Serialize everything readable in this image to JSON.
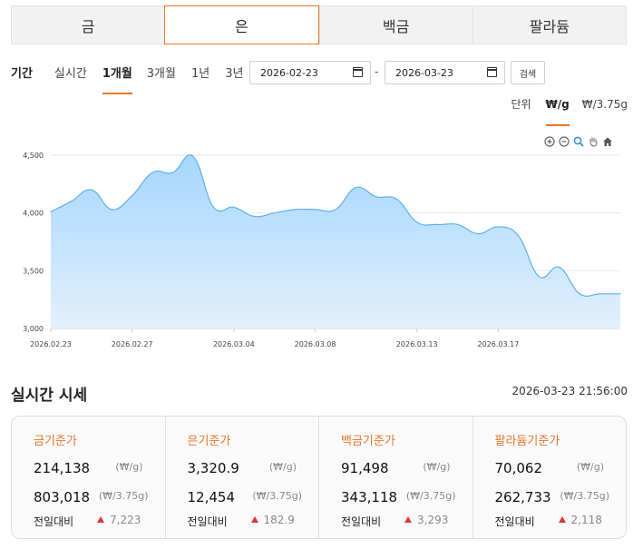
{
  "tabs": [
    {
      "label": "금",
      "active": false
    },
    {
      "label": "은",
      "active": true
    },
    {
      "label": "백금",
      "active": false
    },
    {
      "label": "팔라듐",
      "active": false
    }
  ],
  "period": {
    "label": "기간",
    "options": [
      "실시간",
      "1개월",
      "3개월",
      "1년",
      "3년"
    ],
    "active": "1개월",
    "start_date": "2026-02-23",
    "end_date": "2026-03-23",
    "search_label": "검색"
  },
  "units": {
    "label": "단위",
    "options": [
      "₩/g",
      "₩/3.75g"
    ],
    "active": "₩/g"
  },
  "toolbar_icons": [
    "zoom-in-icon",
    "zoom-out-icon",
    "magnify-icon",
    "pan-hand-icon",
    "home-icon"
  ],
  "colors": {
    "accent": "#e8742c",
    "area_top": "#a6d6ff",
    "area_bottom": "#e2f0fd",
    "line": "#5ab0ec",
    "up": "#e0332f"
  },
  "chart_data": {
    "type": "area",
    "title": "",
    "xlabel": "",
    "ylabel": "",
    "ylim": [
      3000,
      4500
    ],
    "yticks": [
      3000,
      3500,
      4000,
      4500
    ],
    "ytick_labels": [
      "3,000",
      "3,500",
      "4,000",
      "4,500"
    ],
    "xtick_labels": [
      "2026.02.23",
      "2026.02.27",
      "2026.03.04",
      "2026.03.08",
      "2026.03.13",
      "2026.03.17"
    ],
    "grid": true,
    "x": [
      "2026.02.23",
      "2026.02.24",
      "2026.02.25",
      "2026.02.26",
      "2026.02.27",
      "2026.02.28",
      "2026.03.01",
      "2026.03.02",
      "2026.03.03",
      "2026.03.04",
      "2026.03.05",
      "2026.03.06",
      "2026.03.07",
      "2026.03.08",
      "2026.03.09",
      "2026.03.10",
      "2026.03.11",
      "2026.03.12",
      "2026.03.13",
      "2026.03.14",
      "2026.03.15",
      "2026.03.16",
      "2026.03.17",
      "2026.03.18",
      "2026.03.19",
      "2026.03.20",
      "2026.03.21",
      "2026.03.22",
      "2026.03.23"
    ],
    "values": [
      4010,
      4100,
      4200,
      4030,
      4150,
      4350,
      4350,
      4490,
      4050,
      4050,
      3970,
      4000,
      4030,
      4030,
      4030,
      4220,
      4140,
      4120,
      3920,
      3900,
      3900,
      3820,
      3880,
      3800,
      3450,
      3530,
      3300,
      3300,
      3300
    ]
  },
  "realtime": {
    "title": "실시간 시세",
    "timestamp": "2026-03-23 21:56:00",
    "items": [
      {
        "title": "금기준가",
        "per_g": "214,138",
        "per_g_unit": "(₩/g)",
        "per_don": "803,018",
        "per_don_unit": "(₩/3.75g)",
        "change_label": "전일대비",
        "change": "7,223"
      },
      {
        "title": "은기준가",
        "per_g": "3,320.9",
        "per_g_unit": "(₩/g)",
        "per_don": "12,454",
        "per_don_unit": "(₩/3.75g)",
        "change_label": "전일대비",
        "change": "182.9"
      },
      {
        "title": "백금기준가",
        "per_g": "91,498",
        "per_g_unit": "(₩/g)",
        "per_don": "343,118",
        "per_don_unit": "(₩/3.75g)",
        "change_label": "전일대비",
        "change": "3,293"
      },
      {
        "title": "팔라듐기준가",
        "per_g": "70,062",
        "per_g_unit": "(₩/g)",
        "per_don": "262,733",
        "per_don_unit": "(₩/3.75g)",
        "change_label": "전일대비",
        "change": "2,118"
      }
    ]
  }
}
